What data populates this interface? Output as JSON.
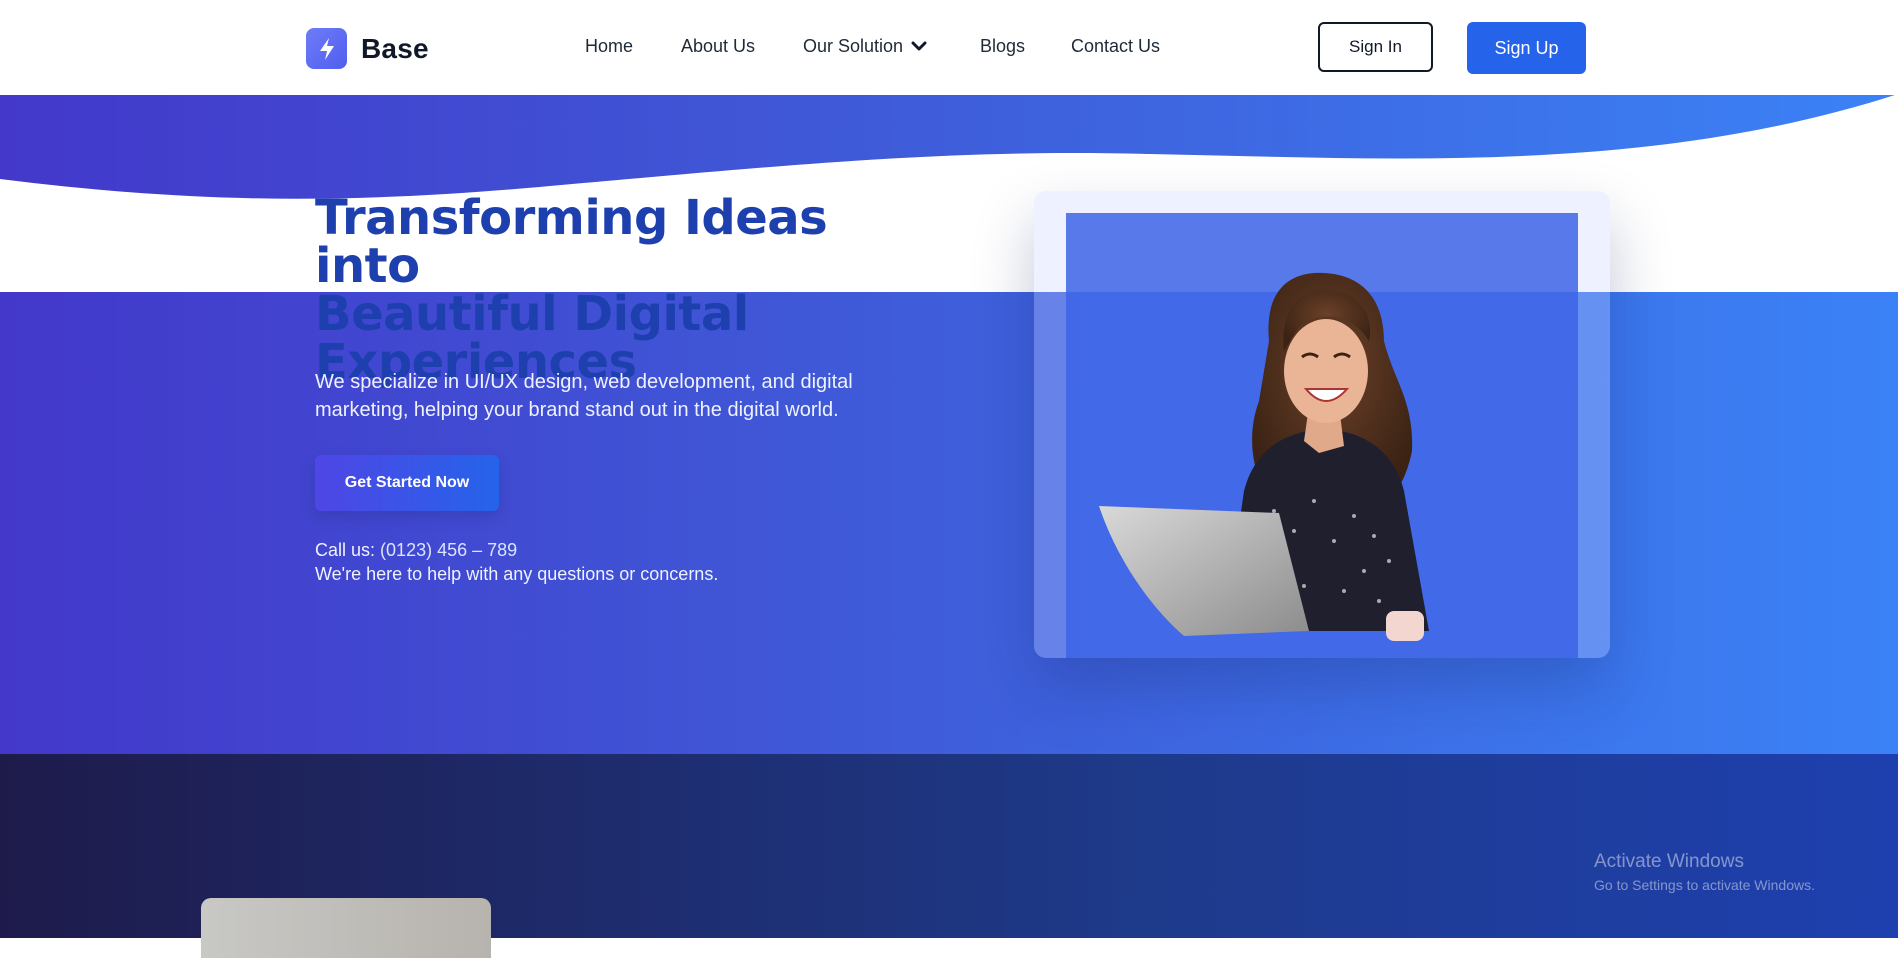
{
  "brand": {
    "name": "Base",
    "color": "#5865f2"
  },
  "nav": {
    "home": "Home",
    "about": "About Us",
    "solution": "Our Solution",
    "blogs": "Blogs",
    "contact": "Contact Us"
  },
  "auth": {
    "sign_in": "Sign In",
    "sign_up": "Sign Up"
  },
  "hero": {
    "title_line1": "Transforming Ideas into",
    "title_line2": "Beautiful Digital",
    "title_line3": "Experiences",
    "description": "We specialize in UI/UX design, web development, and digital marketing, helping your brand stand out in the digital world.",
    "cta": "Get Started Now",
    "call_label": "Call us:",
    "phone": "(0123) 456 – 789",
    "help": "We're here to help with any questions or concerns."
  },
  "os_overlay": {
    "title": "Activate Windows",
    "subtitle": "Go to Settings to activate Windows."
  },
  "colors": {
    "primary": "#2563eb",
    "hero_start": "#4338ca",
    "hero_end": "#3b82f6",
    "title": "#1e40af"
  },
  "icons": {
    "logo": "bolt-icon",
    "dropdown": "chevron-down-icon"
  }
}
